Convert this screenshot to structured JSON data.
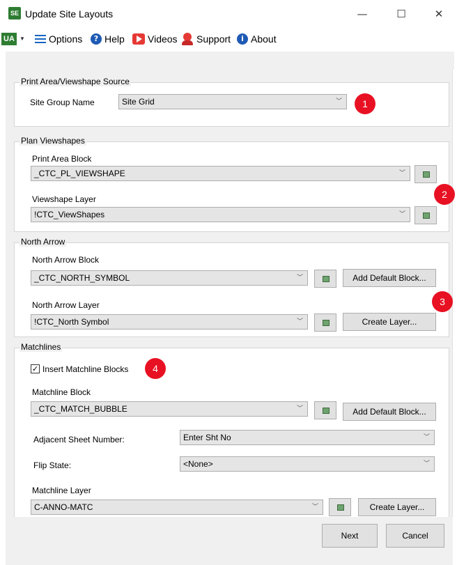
{
  "window": {
    "app_icon_text": "SE",
    "title": "Update Site Layouts",
    "minimize_glyph": "—",
    "maximize_glyph": "☐",
    "close_glyph": "✕"
  },
  "toolbar": {
    "logo_text": "UA",
    "options_label": "Options",
    "help_label": "Help",
    "videos_label": "Videos",
    "support_label": "Support",
    "about_label": "About",
    "icons": [
      "ua-logo-icon",
      "list-icon",
      "help-icon",
      "play-icon",
      "support-icon",
      "info-icon"
    ],
    "help_icon_glyph": "?",
    "about_icon_glyph": "i",
    "help_icon_color": "#1e5ab4",
    "about_icon_color": "#1e5ab4"
  },
  "print_area_group": {
    "title": "Print Area/Viewshape Source",
    "site_group_label": "Site Group Name",
    "site_group_value": "Site Grid"
  },
  "plan_viewshapes_group": {
    "title": "Plan Viewshapes",
    "print_area_block_label": "Print Area Block",
    "print_area_block_value": "_CTC_PL_VIEWSHAPE",
    "viewshape_layer_label": "Viewshape Layer",
    "viewshape_layer_value": "!CTC_ViewShapes"
  },
  "north_arrow_group": {
    "title": "North Arrow",
    "block_label": "North Arrow Block",
    "block_value": "_CTC_NORTH_SYMBOL",
    "add_default_block_label": "Add Default Block...",
    "layer_label": "North Arrow Layer",
    "layer_value": "!CTC_North Symbol",
    "create_layer_label": "Create Layer..."
  },
  "matchlines_group": {
    "title": "Matchlines",
    "insert_checkbox_label": "Insert Matchline Blocks",
    "insert_checked": true,
    "check_glyph": "✓",
    "block_label": "Matchline Block",
    "block_value": "_CTC_MATCH_BUBBLE",
    "add_default_block_label": "Add Default Block...",
    "adjacent_sheet_label": "Adjacent Sheet Number:",
    "adjacent_sheet_value": "Enter Sht No",
    "flip_state_label": "Flip State:",
    "flip_state_value": "<None>",
    "layer_label": "Matchline Layer",
    "layer_value": "C-ANNO-MATC",
    "create_layer_label": "Create Layer..."
  },
  "footer": {
    "next_label": "Next",
    "cancel_label": "Cancel"
  },
  "callouts": [
    "1",
    "2",
    "3",
    "4"
  ],
  "colors": {
    "callout_red": "#e81123",
    "brand_green": "#2e7d32",
    "dialog_bg": "#f0f0f0"
  },
  "dropdown_glyph": "﹀"
}
